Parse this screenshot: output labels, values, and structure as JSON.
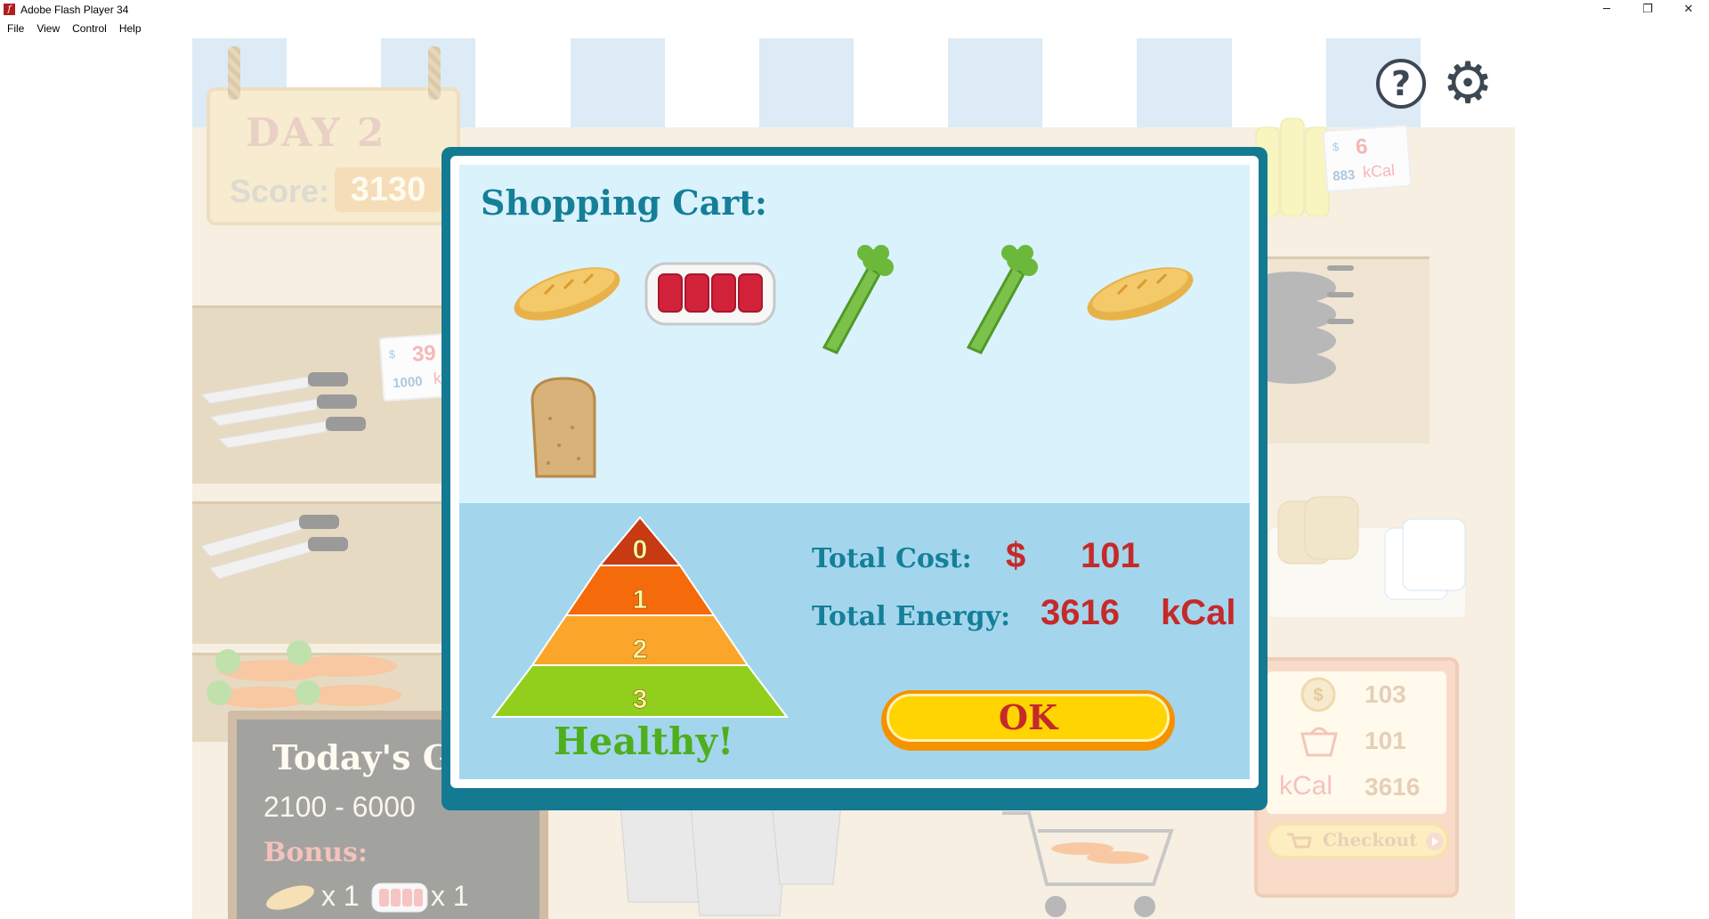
{
  "window": {
    "title": "Adobe Flash Player 34",
    "controls": [
      "─",
      "❐",
      "✕"
    ]
  },
  "menu": [
    "File",
    "View",
    "Control",
    "Help"
  ],
  "game": {
    "day": "DAY 2",
    "score_label": "Score:",
    "score": "3130",
    "price_tag_left": {
      "dollar": "$",
      "price": "39",
      "cal": "1000",
      "unit": "kC"
    },
    "price_tag_right": {
      "dollar": "$",
      "price": "6",
      "cal": "883",
      "unit": "kCal"
    },
    "chalkboard": {
      "goal": "Today's G",
      "range": "2100 - 6000",
      "bonus": "Bonus:",
      "bonus_items": [
        {
          "icon": "bread-icon",
          "qty": "x 1"
        },
        {
          "icon": "meat-icon",
          "qty": "x 1"
        }
      ]
    },
    "stats": {
      "money": "103",
      "cart": "101",
      "kcal_label": "kCal",
      "kcal": "3616",
      "checkout": "Checkout"
    }
  },
  "dialog": {
    "title": "Shopping Cart:",
    "items": [
      "baguette",
      "raw-meat",
      "celery",
      "celery",
      "baguette",
      "bread-slice"
    ],
    "total_cost_label": "Total Cost:",
    "currency": "$",
    "total_cost": "101",
    "total_energy_label": "Total Energy:",
    "total_energy": "3616",
    "energy_unit": "kCal",
    "pyramid_levels": [
      "0",
      "1",
      "2",
      "3"
    ],
    "pyramid_colors": [
      "#c83a12",
      "#f56a0a",
      "#fba52a",
      "#92cf1d"
    ],
    "verdict": "Healthy!",
    "ok": "OK"
  }
}
